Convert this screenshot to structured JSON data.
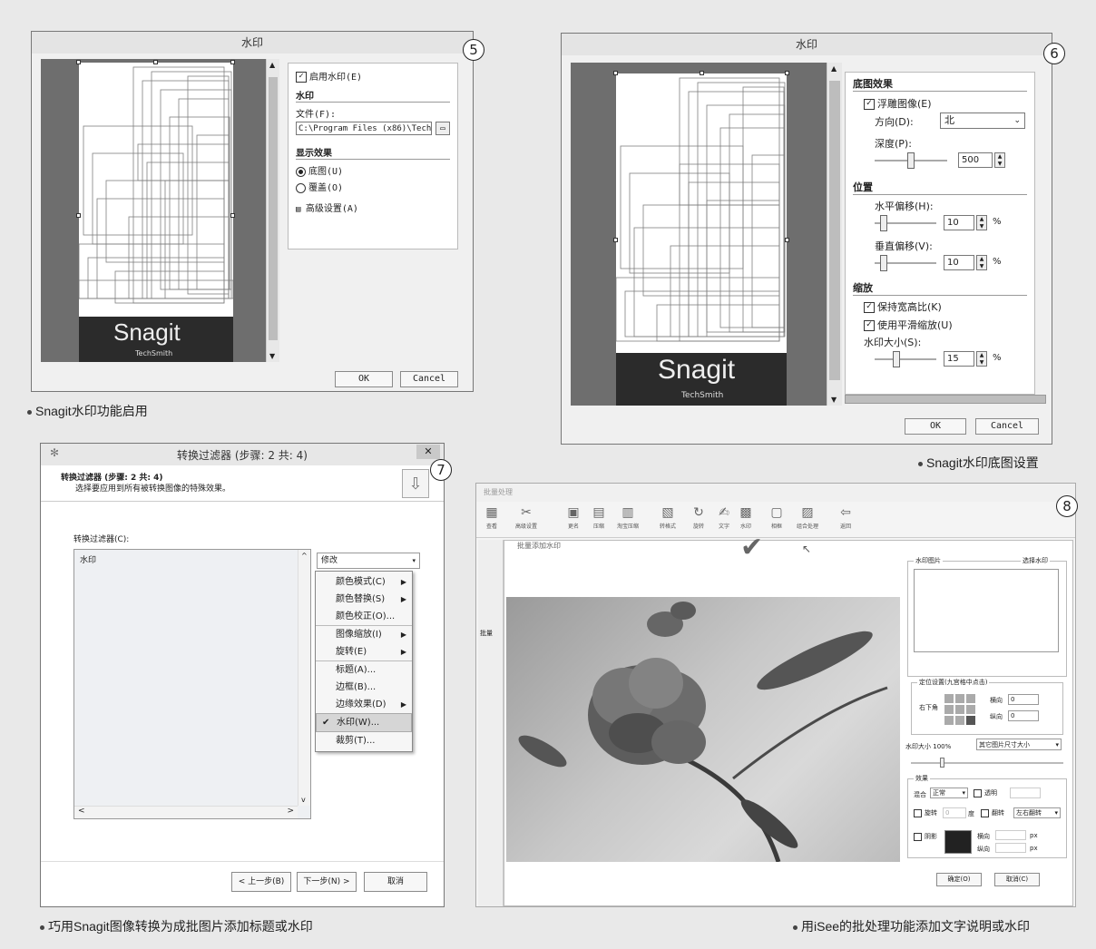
{
  "panel5": {
    "title": "水印",
    "badge": "5",
    "enable_label": "启用水印(E)",
    "section_watermark": "水印",
    "file_label": "文件(F):",
    "file_path": "C:\\Program Files (x86)\\TechS",
    "section_display": "显示效果",
    "radio_underlay": "底图(U)",
    "radio_overlay": "覆盖(O)",
    "advanced": "高级设置(A)",
    "ok": "OK",
    "cancel": "Cancel",
    "snagit": "Snagit",
    "techsmith": "TechSmith",
    "caption": "Snagit水印功能启用"
  },
  "panel6": {
    "title": "水印",
    "badge": "6",
    "section_effect": "底图效果",
    "emboss": "浮雕图像(E)",
    "direction_label": "方向(D):",
    "direction_value": "北",
    "depth_label": "深度(P):",
    "depth_value": "500",
    "section_position": "位置",
    "hoffset_label": "水平偏移(H):",
    "hoffset_value": "10",
    "voffset_label": "垂直偏移(V):",
    "voffset_value": "10",
    "percent": "%",
    "section_scale": "缩放",
    "keep_ratio": "保持宽高比(K)",
    "smooth": "使用平滑缩放(U)",
    "size_label": "水印大小(S):",
    "size_value": "15",
    "ok": "OK",
    "cancel": "Cancel",
    "snagit": "Snagit",
    "techsmith": "TechSmith",
    "caption": "Snagit水印底图设置"
  },
  "panel7": {
    "title": "转换过滤器 (步骤: 2 共: 4)",
    "badge": "7",
    "header_title": "转换过滤器 (步骤: 2 共: 4)",
    "header_sub": "选择要应用到所有被转换图像的特殊效果。",
    "filters_label": "转换过滤器(C):",
    "list_item": "水印",
    "modify": "修改",
    "menu": [
      {
        "label": "颜色模式(C)",
        "arrow": true,
        "checked": false,
        "sep_after": false
      },
      {
        "label": "颜色替换(S)",
        "arrow": true,
        "checked": false,
        "sep_after": false
      },
      {
        "label": "颜色校正(O)...",
        "arrow": false,
        "checked": false,
        "sep_after": true
      },
      {
        "label": "图像缩放(I)",
        "arrow": true,
        "checked": false,
        "sep_after": false
      },
      {
        "label": "旋转(E)",
        "arrow": true,
        "checked": false,
        "sep_after": true
      },
      {
        "label": "标题(A)...",
        "arrow": false,
        "checked": false,
        "sep_after": false
      },
      {
        "label": "边框(B)...",
        "arrow": false,
        "checked": false,
        "sep_after": false
      },
      {
        "label": "边缘效果(D)",
        "arrow": true,
        "checked": false,
        "sep_after": false
      },
      {
        "label": "水印(W)...",
        "arrow": false,
        "checked": true,
        "sep_after": false
      },
      {
        "label": "裁剪(T)...",
        "arrow": false,
        "checked": false,
        "sep_after": false
      }
    ],
    "prev": "< 上一步(B)",
    "next": "下一步(N) >",
    "cancel": "取消",
    "caption": "巧用Snagit图像转换为成批图片添加标题或水印"
  },
  "panel8": {
    "badge": "8",
    "app_title": "批量处理",
    "toolbar": [
      "查看",
      "高级设置",
      "更名",
      "压缩",
      "淘宝压缩",
      "转格式",
      "旋转",
      "文字",
      "水印",
      "相框",
      "组合处理",
      "返回"
    ],
    "dialog_title": "批量添加水印",
    "side_left": "批量",
    "wm_image_label": "水印图片",
    "choose_wm": "选择水印",
    "pos_label": "定位设置(九宫格中点击)",
    "pos_corner": "右下角",
    "h_label": "横向",
    "v_label": "纵向",
    "h_value": "0",
    "v_value": "0",
    "size_label": "水印大小",
    "size_value": "100%",
    "size_mode": "其它图片尺寸大小",
    "effect_label": "效果",
    "blend_label": "混合",
    "blend_value": "正常",
    "transparent": "透明",
    "rotate": "旋转",
    "rotate_value": "0",
    "deg": "度",
    "flip": "翻转",
    "flip_value": "左右翻转",
    "shadow": "阴影",
    "sh_h": "横向",
    "sh_v": "纵向",
    "px": "px",
    "ok": "确定(O)",
    "cancel": "取消(C)",
    "caption": "用iSee的批处理功能添加文字说明或水印"
  }
}
